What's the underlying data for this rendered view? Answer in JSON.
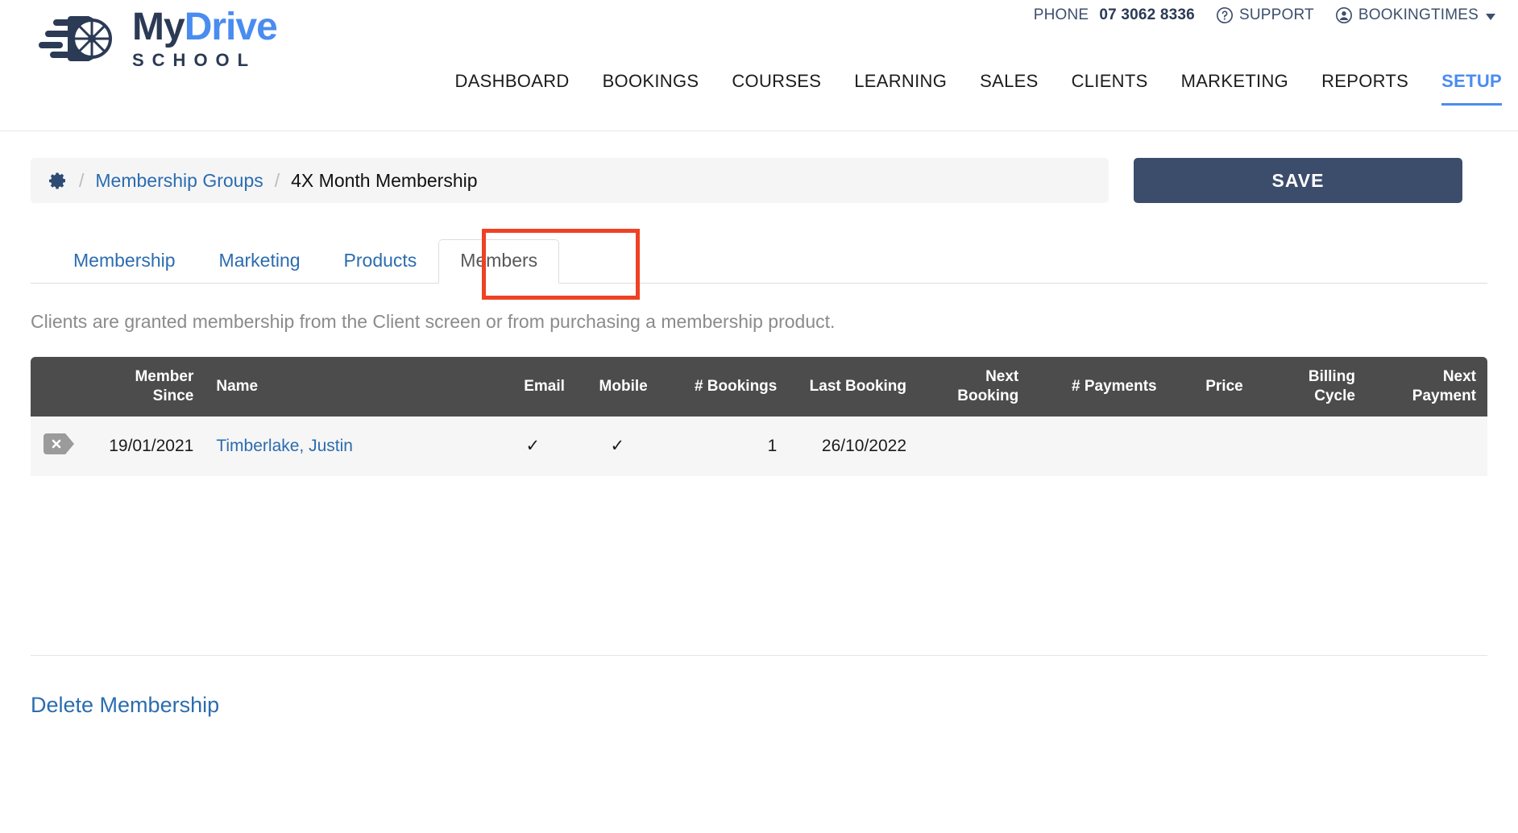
{
  "brand": {
    "logo_title_part1": "My",
    "logo_title_part2": "Drive",
    "logo_subtitle": "SCHOOL",
    "color_navy": "#2b3a55",
    "color_blue": "#4a8cf0"
  },
  "utility": {
    "phone_label": "PHONE",
    "phone_number": "07 3062 8336",
    "support_label": "SUPPORT",
    "account_label": "BOOKINGTIMES"
  },
  "nav": {
    "items": [
      {
        "label": "DASHBOARD",
        "active": false
      },
      {
        "label": "BOOKINGS",
        "active": false
      },
      {
        "label": "COURSES",
        "active": false
      },
      {
        "label": "LEARNING",
        "active": false
      },
      {
        "label": "SALES",
        "active": false
      },
      {
        "label": "CLIENTS",
        "active": false
      },
      {
        "label": "MARKETING",
        "active": false
      },
      {
        "label": "REPORTS",
        "active": false
      },
      {
        "label": "SETUP",
        "active": true
      }
    ]
  },
  "breadcrumb": {
    "separator": "/",
    "parent_label": "Membership Groups",
    "current_label": "4X Month Membership"
  },
  "toolbar": {
    "save_label": "SAVE"
  },
  "tabs": [
    {
      "label": "Membership",
      "active": false
    },
    {
      "label": "Marketing",
      "active": false
    },
    {
      "label": "Products",
      "active": false
    },
    {
      "label": "Members",
      "active": true
    }
  ],
  "annotation": {
    "color": "#ef4123",
    "target": "Members"
  },
  "main": {
    "note": "Clients are granted membership from the Client screen or from purchasing a membership product."
  },
  "table": {
    "columns": [
      {
        "label": "",
        "align": "left"
      },
      {
        "label": "Member Since",
        "align": "right"
      },
      {
        "label": "Name",
        "align": "left"
      },
      {
        "label": "Email",
        "align": "right"
      },
      {
        "label": "Mobile",
        "align": "right"
      },
      {
        "label": "# Bookings",
        "align": "right"
      },
      {
        "label": "Last Booking",
        "align": "right"
      },
      {
        "label": "Next Booking",
        "align": "right"
      },
      {
        "label": "# Payments",
        "align": "right"
      },
      {
        "label": "Price",
        "align": "right"
      },
      {
        "label": "Billing Cycle",
        "align": "right"
      },
      {
        "label": "Next Payment",
        "align": "right"
      }
    ],
    "rows": [
      {
        "remove_icon": "remove-tag-icon",
        "member_since": "19/01/2021",
        "name": "Timberlake, Justin",
        "email": "✓",
        "mobile": "✓",
        "bookings": "1",
        "last_booking": "26/10/2022",
        "next_booking": "",
        "payments": "",
        "price": "",
        "billing_cycle": "",
        "next_payment": ""
      }
    ]
  },
  "footer": {
    "delete_label": "Delete Membership"
  }
}
